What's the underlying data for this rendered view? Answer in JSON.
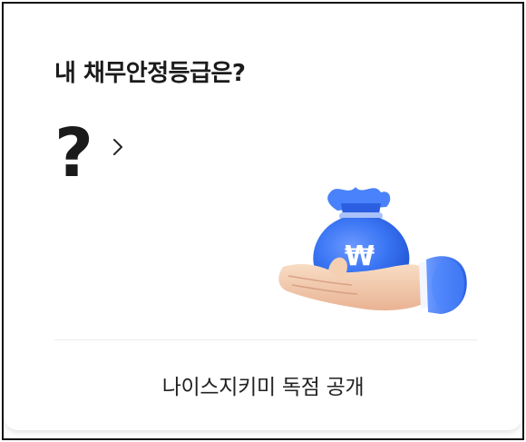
{
  "card": {
    "title": "내 채무안정등급은?",
    "grade_value": "?",
    "footer_link": "나이스지키미 독점 공개"
  },
  "icons": {
    "chevron": "chevron-right-icon",
    "illustration": "money-bag-in-hand-icon",
    "currency_symbol": "₩"
  },
  "colors": {
    "bag_blue": "#2f6df2",
    "bag_blue_light": "#5a8bfa",
    "sleeve_blue": "#3d7cf5",
    "skin": "#f2c7a6",
    "text_dark": "#1b1b1b"
  }
}
